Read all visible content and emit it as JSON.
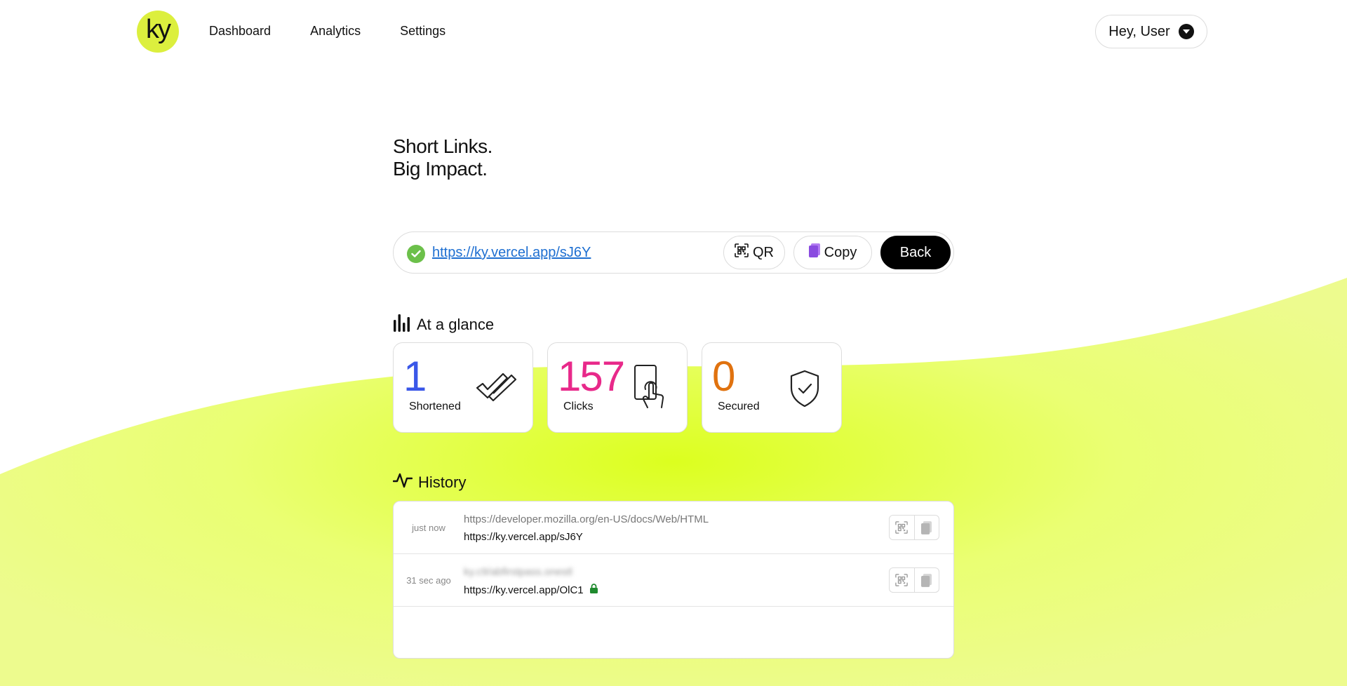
{
  "header": {
    "logo_text": "ky",
    "nav": [
      {
        "label": "Dashboard"
      },
      {
        "label": "Analytics"
      },
      {
        "label": "Settings"
      }
    ],
    "user_greeting": "Hey, User"
  },
  "hero": {
    "line1": "Short Links.",
    "line2": "Big Impact."
  },
  "result": {
    "short_url": "https://ky.vercel.app/sJ6Y",
    "status_icon": "check-circle-icon",
    "qr_label": "QR",
    "copy_label": "Copy",
    "back_label": "Back"
  },
  "glance": {
    "title": "At a glance",
    "icon": "bar-chart-icon",
    "stats": [
      {
        "value": "1",
        "label": "Shortened",
        "color": "#3a57e8",
        "icon": "double-check-icon"
      },
      {
        "value": "157",
        "label": "Clicks",
        "color": "#e8298a",
        "icon": "tap-phone-icon"
      },
      {
        "value": "0",
        "label": "Secured",
        "color": "#e0720f",
        "icon": "shield-check-icon"
      }
    ]
  },
  "history": {
    "title": "History",
    "icon": "activity-icon",
    "rows": [
      {
        "time": "just now",
        "original": "https://developer.mozilla.org/en-US/docs/Web/HTML",
        "short": "https://ky.vercel.app/sJ6Y",
        "locked": false
      },
      {
        "time": "31 sec ago",
        "original": "ky.c9/abfirstpass.onestl",
        "short": "https://ky.vercel.app/OlC1",
        "locked": true
      }
    ]
  },
  "colors": {
    "accent": "#dcef3e",
    "link": "#1e6fd1",
    "success": "#6cc04a",
    "lock": "#1f8a2e"
  }
}
